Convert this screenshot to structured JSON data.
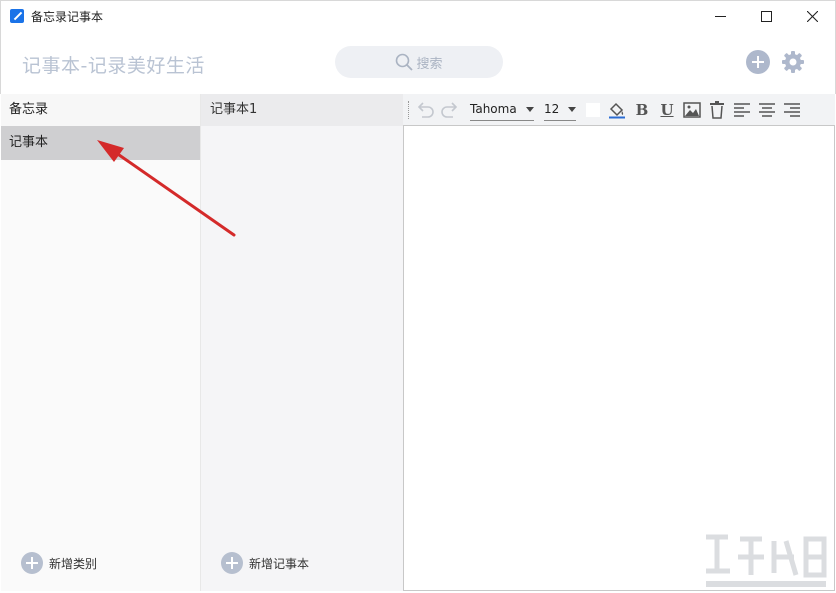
{
  "window": {
    "title": "备忘录记事本"
  },
  "header": {
    "brand": "记事本-记录美好生活",
    "search_placeholder": "搜索"
  },
  "categories": {
    "header": "备忘录",
    "items": [
      {
        "label": "记事本",
        "selected": true
      }
    ],
    "add_label": "新增类别"
  },
  "notes": {
    "items": [
      {
        "label": "记事本1"
      }
    ],
    "add_label": "新增记事本"
  },
  "toolbar": {
    "font": "Tahoma",
    "size": "12",
    "bold_glyph": "B",
    "underline_glyph": "U"
  },
  "colors": {
    "accent_icon": "#aeb8cc",
    "selected_row": "#cfcfd1",
    "annotation_arrow": "#d42a2a"
  }
}
